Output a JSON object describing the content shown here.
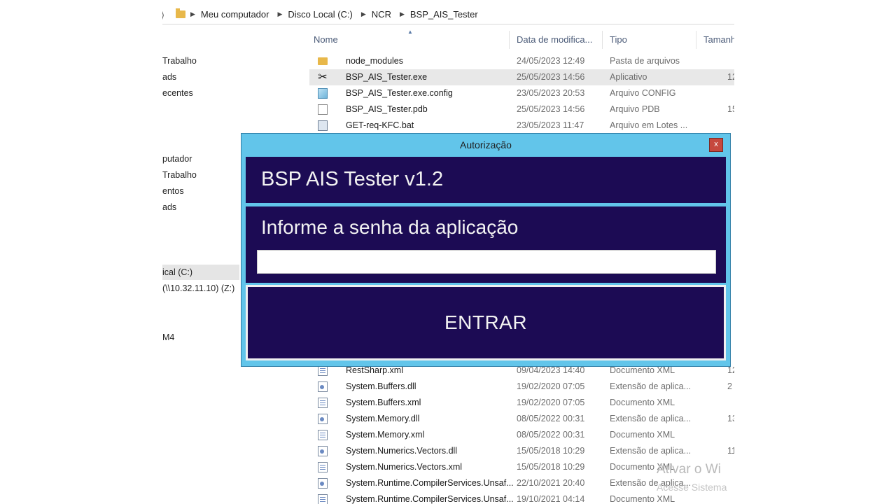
{
  "explorer": {
    "breadcrumbs": [
      "Meu computador",
      "Disco Local (C:)",
      "NCR",
      "BSP_AIS_Tester"
    ],
    "nav_items": [
      {
        "label": "Trabalho"
      },
      {
        "label": "ads"
      },
      {
        "label": "ecentes"
      },
      {
        "label": "putador"
      },
      {
        "label": "Trabalho"
      },
      {
        "label": "entos"
      },
      {
        "label": "ads"
      },
      {
        "label": "ical (C:)"
      },
      {
        "label": "(\\\\10.32.11.10) (Z:)"
      },
      {
        "label": "M4"
      }
    ],
    "columns": [
      "Nome",
      "Data de modifica...",
      "Tipo",
      "Tamanh"
    ],
    "files": [
      {
        "name": "node_modules",
        "date": "24/05/2023 12:49",
        "type": "Pasta de arquivos",
        "size": "",
        "icon": "folder-icon"
      },
      {
        "name": "BSP_AIS_Tester.exe",
        "date": "25/05/2023 14:56",
        "type": "Aplicativo",
        "size": "12",
        "icon": "exe-tools-icon"
      },
      {
        "name": "BSP_AIS_Tester.exe.config",
        "date": "23/05/2023 20:53",
        "type": "Arquivo CONFIG",
        "size": "",
        "icon": "config-file-icon"
      },
      {
        "name": "BSP_AIS_Tester.pdb",
        "date": "25/05/2023 14:56",
        "type": "Arquivo PDB",
        "size": "15",
        "icon": "document-icon"
      },
      {
        "name": "GET-req-KFC.bat",
        "date": "23/05/2023 11:47",
        "type": "Arquivo em Lotes ...",
        "size": "",
        "icon": "batch-file-icon"
      },
      {
        "name": "RestSharp.xml",
        "date": "09/04/2023 14:40",
        "type": "Documento XML",
        "size": "12",
        "icon": "xml-file-icon"
      },
      {
        "name": "System.Buffers.dll",
        "date": "19/02/2020 07:05",
        "type": "Extensão de aplica...",
        "size": "2",
        "icon": "dll-file-icon"
      },
      {
        "name": "System.Buffers.xml",
        "date": "19/02/2020 07:05",
        "type": "Documento XML",
        "size": "",
        "icon": "xml-file-icon"
      },
      {
        "name": "System.Memory.dll",
        "date": "08/05/2022 00:31",
        "type": "Extensão de aplica...",
        "size": "13",
        "icon": "dll-file-icon"
      },
      {
        "name": "System.Memory.xml",
        "date": "08/05/2022 00:31",
        "type": "Documento XML",
        "size": "",
        "icon": "xml-file-icon"
      },
      {
        "name": "System.Numerics.Vectors.dll",
        "date": "15/05/2018 10:29",
        "type": "Extensão de aplica...",
        "size": "11",
        "icon": "dll-file-icon"
      },
      {
        "name": "System.Numerics.Vectors.xml",
        "date": "15/05/2018 10:29",
        "type": "Documento XML",
        "size": "",
        "icon": "xml-file-icon"
      },
      {
        "name": "System.Runtime.CompilerServices.Unsaf...",
        "date": "22/10/2021 20:40",
        "type": "Extensão de aplica...",
        "size": "",
        "icon": "dll-file-icon"
      },
      {
        "name": "System.Runtime.CompilerServices.Unsaf...",
        "date": "19/10/2021 04:14",
        "type": "Documento XML",
        "size": "",
        "icon": "xml-file-icon"
      }
    ],
    "watermark_line1": "Ativar o Wi",
    "watermark_line2": "Acesse Sistema"
  },
  "dialog": {
    "title": "Autorização",
    "close_label": "x",
    "app_title": "BSP AIS Tester v1.2",
    "prompt": "Informe a senha da aplicação",
    "password_value": "",
    "enter_label": "ENTRAR",
    "colors": {
      "frame": "#62c5ea",
      "panel": "#1c0b54",
      "text": "#f2f2f2",
      "close": "#c6483e"
    }
  }
}
